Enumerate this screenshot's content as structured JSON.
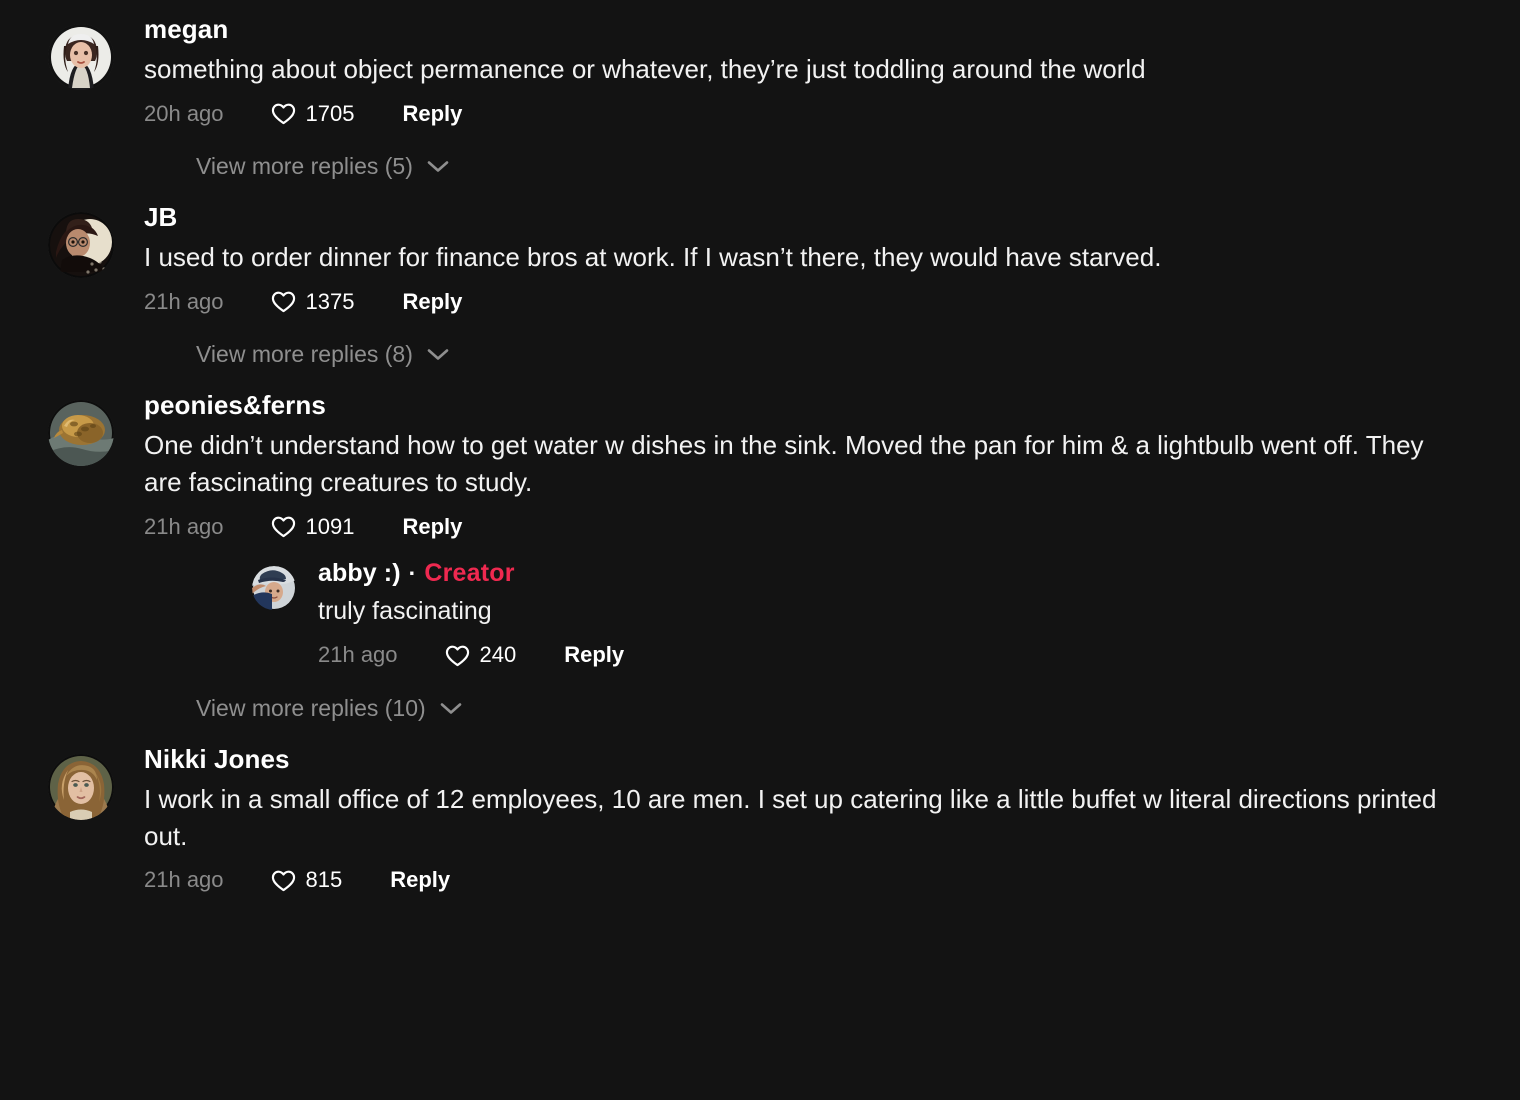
{
  "app": {
    "surface": "tiktok-comment-thread",
    "background_color": "#131313",
    "accent_color": "#ef2950",
    "text_color": "#ffffff",
    "muted_text_color": "#8a8a8a"
  },
  "labels": {
    "reply": "Reply",
    "creator_badge": "Creator",
    "creator_separator": "·",
    "heart_icon": "heart-outline-icon",
    "chevron_icon": "chevron-down-icon"
  },
  "comments": [
    {
      "username": "megan",
      "text": "something about object permanence or whatever, they’re just toddling around the world",
      "timestamp": "20h ago",
      "likes": "1705",
      "reply_label": "Reply",
      "view_more_label": "View more replies (5)",
      "avatar": "avatar-megan",
      "is_creator": false
    },
    {
      "username": "JB",
      "text": "I used to order dinner for finance bros at work. If I wasn’t there, they would have starved.",
      "timestamp": "21h ago",
      "likes": "1375",
      "reply_label": "Reply",
      "view_more_label": "View more replies (8)",
      "avatar": "avatar-jb",
      "is_creator": false
    },
    {
      "username": "peonies&ferns",
      "text": "One didn’t understand how to get water w dishes in the sink. Moved the pan for him & a lightbulb went off. They are fascinating creatures to study.",
      "timestamp": "21h ago",
      "likes": "1091",
      "reply_label": "Reply",
      "view_more_label": "View more replies (10)",
      "avatar": "avatar-peonies",
      "is_creator": false,
      "replies": [
        {
          "username": "abby :)",
          "text": "truly fascinating",
          "timestamp": "21h ago",
          "likes": "240",
          "reply_label": "Reply",
          "avatar": "avatar-abby",
          "is_creator": true,
          "creator_badge": "Creator",
          "creator_separator": "·"
        }
      ]
    },
    {
      "username": "Nikki Jones",
      "text": "I work in a small office of 12 employees, 10 are men. I set up catering like a little buffet w literal directions printed out.",
      "timestamp": "21h ago",
      "likes": "815",
      "reply_label": "Reply",
      "avatar": "avatar-nikki",
      "is_creator": false
    }
  ]
}
